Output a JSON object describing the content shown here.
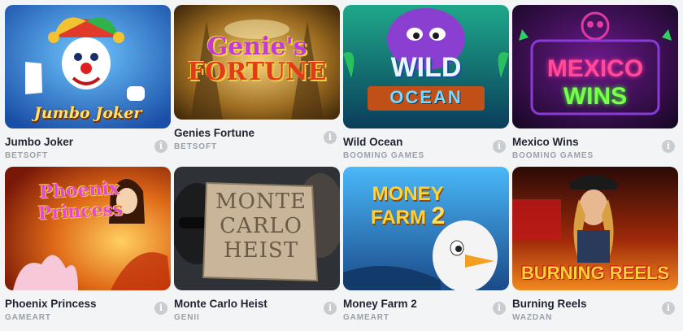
{
  "games": [
    {
      "title": "Jumbo Joker",
      "provider": "BETSOFT",
      "logo": "Jumbo Joker",
      "info_icon": "i",
      "colors": [
        "#2a6fd6",
        "#c93a2a"
      ]
    },
    {
      "title": "Genies Fortune",
      "provider": "BETSOFT",
      "logo_top": "Genie's",
      "logo_bottom": "FORTUNE",
      "info_icon": "i",
      "colors": [
        "#5a3a10",
        "#d49a2a"
      ]
    },
    {
      "title": "Wild Ocean",
      "provider": "BOOMING GAMES",
      "logo_top": "WILD",
      "logo_bottom": "OCEAN",
      "info_icon": "i",
      "colors": [
        "#0b6b66",
        "#7a3fbf"
      ]
    },
    {
      "title": "Mexico Wins",
      "provider": "BOOMING GAMES",
      "logo_top": "MEXICO",
      "logo_bottom": "WINS",
      "info_icon": "i",
      "colors": [
        "#2a0f3a",
        "#e53a8c"
      ]
    },
    {
      "title": "Phoenix Princess",
      "provider": "GAMEART",
      "logo_top": "Phoenix",
      "logo_bottom": "Princess",
      "info_icon": "i",
      "colors": [
        "#b0301a",
        "#f0a030"
      ]
    },
    {
      "title": "Monte Carlo Heist",
      "provider": "GENII",
      "logo_top": "MONTE",
      "logo_mid": "CARLO",
      "logo_bottom": "HEIST",
      "info_icon": "i",
      "colors": [
        "#2b2e32",
        "#c9b79a"
      ]
    },
    {
      "title": "Money Farm 2",
      "provider": "GAMEART",
      "logo_top": "MONEY",
      "logo_bottom": "FARM",
      "logo_num": "2",
      "info_icon": "i",
      "colors": [
        "#2a7fd0",
        "#f2c230"
      ]
    },
    {
      "title": "Burning Reels",
      "provider": "WAZDAN",
      "logo": "BURNING REELS",
      "info_icon": "i",
      "colors": [
        "#5a1208",
        "#f06a18"
      ]
    }
  ]
}
